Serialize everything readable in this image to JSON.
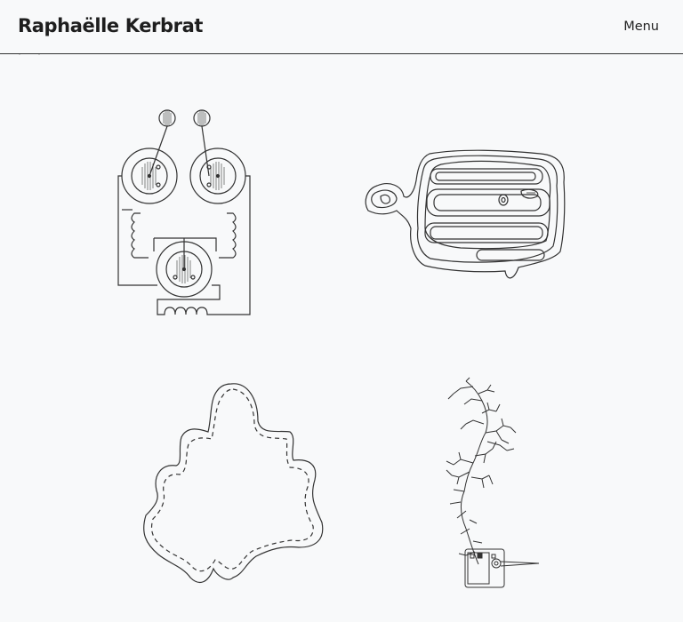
{
  "header": {
    "site_title": "Raphaëlle Kerbrat",
    "menu_label": "Menu"
  },
  "colors": {
    "background": "#f8f9fa",
    "ink": "#333333"
  },
  "gallery": {
    "items": [
      {
        "name": "circuit-drawing-artwork"
      },
      {
        "name": "contour-map-artwork"
      },
      {
        "name": "leaf-outline-artwork"
      },
      {
        "name": "branching-root-artwork"
      }
    ]
  }
}
